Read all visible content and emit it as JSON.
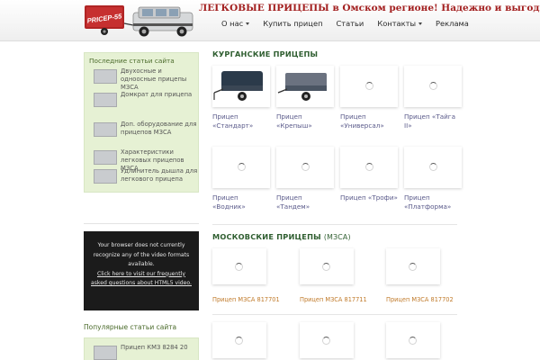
{
  "header": {
    "logo_text": "PRICEP-55",
    "tagline": "ЛЕГКОВЫЕ ПРИЦЕПЫ в Омском регионе! Надежно и выгодно!",
    "nav": [
      {
        "label": "О нас",
        "dropdown": true
      },
      {
        "label": "Купить прицеп",
        "dropdown": false
      },
      {
        "label": "Статьи",
        "dropdown": false
      },
      {
        "label": "Контакты",
        "dropdown": true
      },
      {
        "label": "Реклама",
        "dropdown": false
      }
    ]
  },
  "sidebar": {
    "latest_title": "Последние статьи сайта",
    "latest_items": [
      {
        "label": "Двухосные и одноосные прицепы МЗСА"
      },
      {
        "label": "Домкрат для прицепа"
      },
      {
        "label": "Доп. оборудование для прицепов МЗСА"
      },
      {
        "label": "Характеристики легковых прицепов МЗСА"
      },
      {
        "label": "Удлинитель дышла для легкового прицепа"
      }
    ],
    "video": {
      "line1": "Your browser does not currently recognize any of the video formats available.",
      "link": "Click here to visit our frequently asked questions about HTML5 video."
    },
    "popular_title": "Популярные статьи сайта",
    "popular_items": [
      {
        "label": "Прицеп КМЗ 8284 20"
      }
    ]
  },
  "kurgan": {
    "title": "КУРГАНСКИЕ ПРИЦЕПЫ",
    "items": [
      {
        "name": "Прицеп «Стандарт»",
        "image": "trailer-photo"
      },
      {
        "name": "Прицеп «Крепыш»",
        "image": "trailer-photo"
      },
      {
        "name": "Прицеп «Универсал»",
        "image": "loading-spinner"
      },
      {
        "name": "Прицеп «Тайга II»",
        "image": "loading-spinner"
      },
      {
        "name": "Прицеп «Водник»",
        "image": "loading-spinner"
      },
      {
        "name": "Прицеп «Тандем»",
        "image": "loading-spinner"
      },
      {
        "name": "Прицеп «Трофи»",
        "image": "loading-spinner"
      },
      {
        "name": "Прицеп «Платформа»",
        "image": "loading-spinner"
      }
    ]
  },
  "moscow": {
    "title": "МОСКОВСКИЕ ПРИЦЕПЫ",
    "title_sub": "(МЗСА)",
    "items": [
      {
        "name": "Прицеп МЗСА 817701"
      },
      {
        "name": "Прицеп МЗСА 817711"
      },
      {
        "name": "Прицеп МЗСА 817702"
      }
    ]
  },
  "colors": {
    "tagline": "#a32020",
    "section_title": "#2f5e30",
    "sidebar_bg": "#e6f1d4",
    "caption": "#5a5a8a",
    "moscow_caption": "#c07a2a"
  }
}
